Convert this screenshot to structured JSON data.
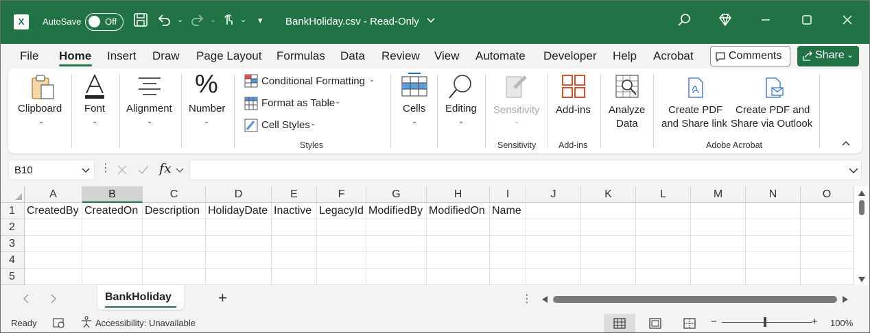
{
  "title_bar": {
    "app_icon": "excel-logo-icon",
    "app_letter": "X",
    "autosave_label": "AutoSave",
    "autosave_state": "Off",
    "document_title": "BankHoliday.csv  -  Read-Only",
    "accent_color": "#217346"
  },
  "menu": {
    "items": [
      "File",
      "Home",
      "Insert",
      "Draw",
      "Page Layout",
      "Formulas",
      "Data",
      "Review",
      "View",
      "Automate",
      "Developer",
      "Help",
      "Acrobat"
    ],
    "active": "Home",
    "comments_label": "Comments",
    "share_label": "Share"
  },
  "ribbon": {
    "clipboard": "Clipboard",
    "font": "Font",
    "alignment": "Alignment",
    "number": "Number",
    "conditional_formatting": "Conditional Formatting",
    "format_as_table": "Format as Table",
    "cell_styles": "Cell Styles",
    "styles_group": "Styles",
    "cells": "Cells",
    "editing": "Editing",
    "sensitivity": "Sensitivity",
    "sensitivity_group": "Sensitivity",
    "addins": "Add-ins",
    "addins_group": "Add-ins",
    "analyze_line1": "Analyze",
    "analyze_line2": "Data",
    "create_pdf_share_link_1": "Create PDF",
    "create_pdf_share_link_2": "and Share link",
    "create_pdf_outlook_1": "Create PDF and",
    "create_pdf_outlook_2": "Share via Outlook",
    "adobe_group": "Adobe Acrobat"
  },
  "formula_bar": {
    "name_box": "B10",
    "fx_label": "fx",
    "formula_value": ""
  },
  "grid": {
    "columns": [
      "A",
      "B",
      "C",
      "D",
      "E",
      "F",
      "G",
      "H",
      "I",
      "J",
      "K",
      "L",
      "M",
      "N",
      "O"
    ],
    "selected_column": "B",
    "rows": [
      {
        "num": "1",
        "cells": [
          "CreatedBy",
          "CreatedOn",
          "Description",
          "HolidayDate",
          "Inactive",
          "LegacyId",
          "ModifiedBy",
          "ModifiedOn",
          "Name",
          "",
          "",
          "",
          "",
          "",
          ""
        ]
      },
      {
        "num": "2",
        "cells": [
          "",
          "",
          "",
          "",
          "",
          "",
          "",
          "",
          "",
          "",
          "",
          "",
          "",
          "",
          ""
        ]
      },
      {
        "num": "3",
        "cells": [
          "",
          "",
          "",
          "",
          "",
          "",
          "",
          "",
          "",
          "",
          "",
          "",
          "",
          "",
          ""
        ]
      },
      {
        "num": "4",
        "cells": [
          "",
          "",
          "",
          "",
          "",
          "",
          "",
          "",
          "",
          "",
          "",
          "",
          "",
          "",
          ""
        ]
      },
      {
        "num": "5",
        "cells": [
          "",
          "",
          "",
          "",
          "",
          "",
          "",
          "",
          "",
          "",
          "",
          "",
          "",
          "",
          ""
        ]
      }
    ]
  },
  "sheets": {
    "tabs": [
      "BankHoliday"
    ],
    "active": "BankHoliday",
    "add_sheet": "+"
  },
  "status_bar": {
    "ready": "Ready",
    "accessibility": "Accessibility: Unavailable",
    "zoom": "100%",
    "zoom_minus": "−",
    "zoom_plus": "+"
  }
}
